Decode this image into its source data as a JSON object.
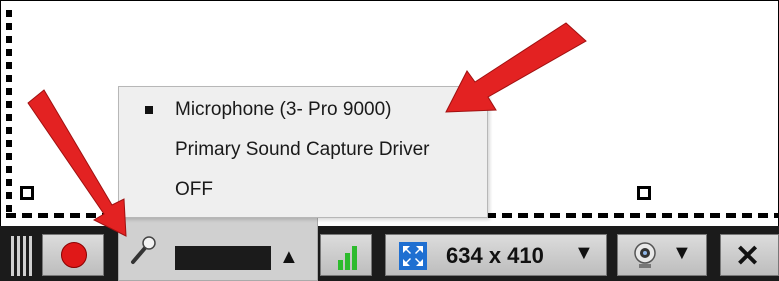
{
  "audio_menu": {
    "items": [
      {
        "label": "Microphone (3- Pro 9000)",
        "selected": true
      },
      {
        "label": "Primary Sound Capture Driver",
        "selected": false
      },
      {
        "label": "OFF",
        "selected": false
      }
    ]
  },
  "toolbar": {
    "size_label": "634 x 410",
    "size_dropdown_icon": "▼",
    "mic_menu_toggle_icon": "▲",
    "webcam_dropdown_icon": "▼",
    "close_icon": "✕"
  },
  "colors": {
    "toolbar_bg": "#1b1b1b",
    "record_red": "#e01818",
    "annotation_arrow": "#e32222",
    "signal_green": "#2dbb2d",
    "resize_blue": "#1f6fd1"
  }
}
